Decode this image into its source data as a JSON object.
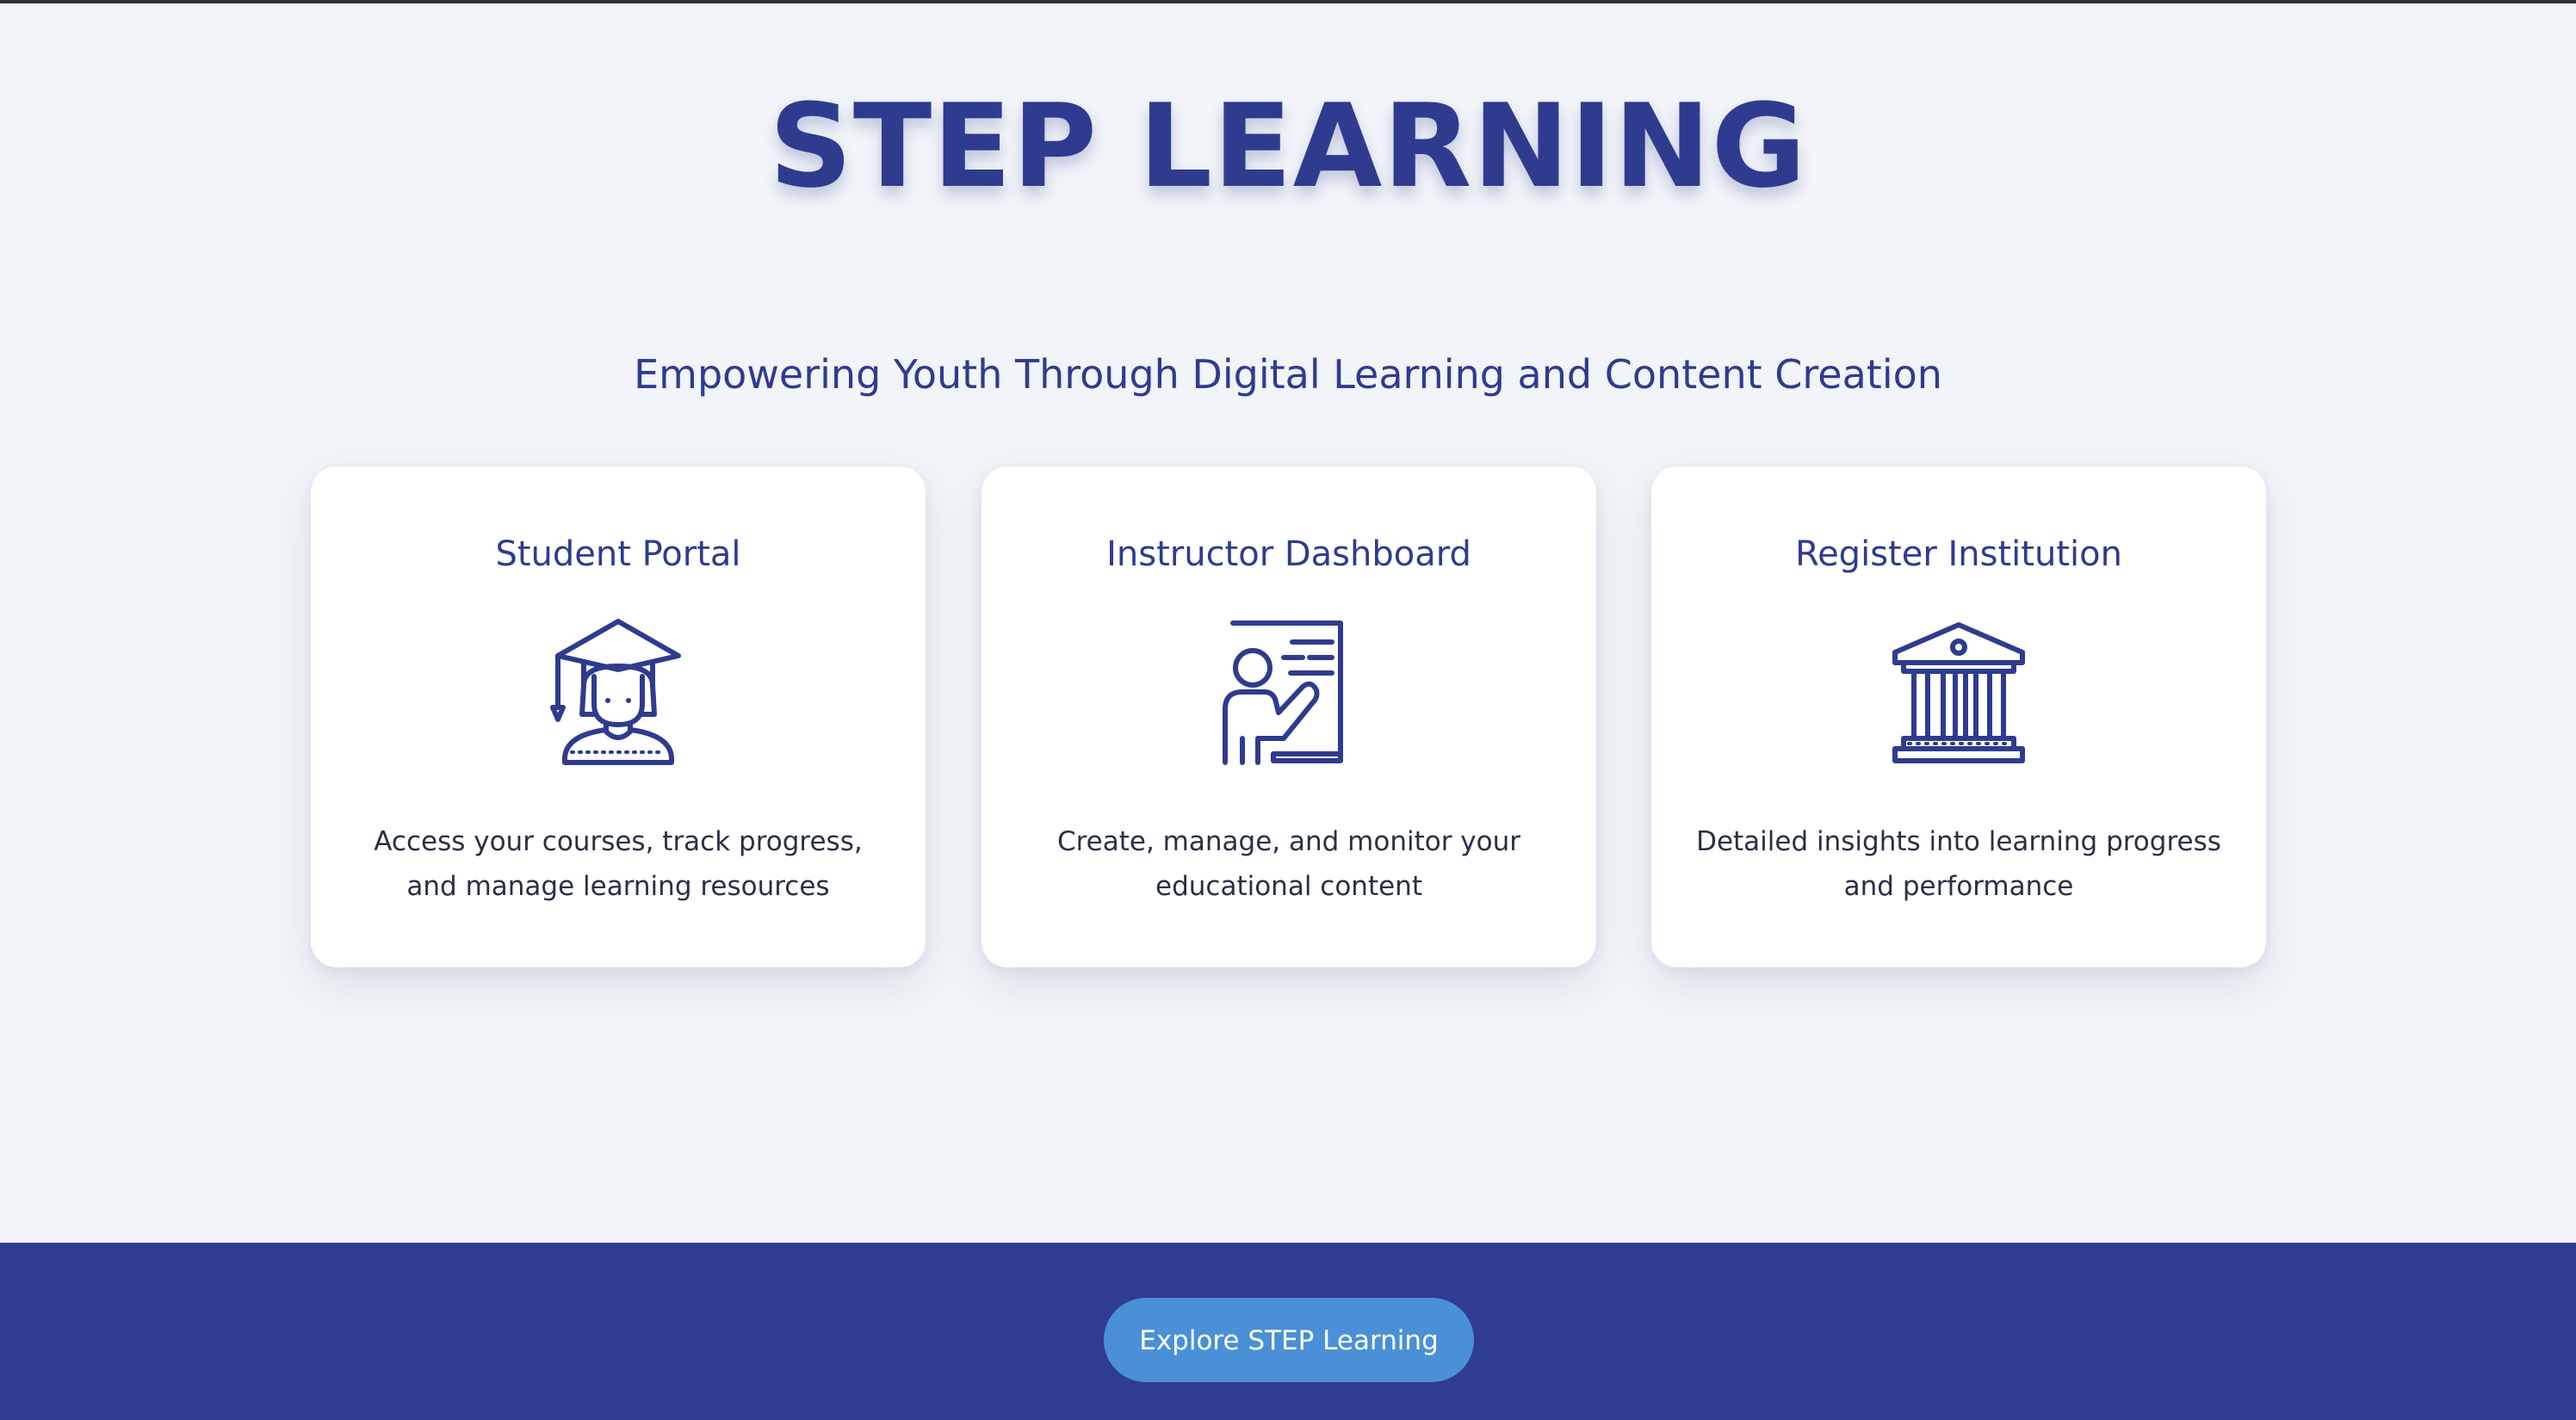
{
  "header": {
    "title": "STEP LEARNING",
    "subtitle": "Empowering Youth Through Digital Learning and Content Creation"
  },
  "cards": [
    {
      "title": "Student Portal",
      "icon": "student-graduate-icon",
      "description": "Access your courses, track progress, and manage learning resources"
    },
    {
      "title": "Instructor Dashboard",
      "icon": "teacher-board-icon",
      "description": "Create, manage, and monitor your educational content"
    },
    {
      "title": "Register Institution",
      "icon": "institution-building-icon",
      "description": "Detailed insights into learning progress and performance"
    }
  ],
  "footer": {
    "cta_label": "Explore STEP Learning"
  },
  "colors": {
    "primary": "#2f3b8f",
    "footer_bg": "#303c91",
    "cta_bg": "#4a90d6",
    "page_bg": "#f1f4f8"
  }
}
